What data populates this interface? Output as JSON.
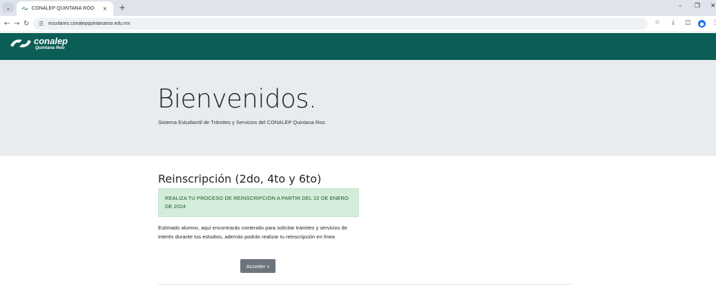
{
  "browser": {
    "tab_title": "CONALEP QUINTANA ROO",
    "tab_close": "×",
    "new_tab": "+",
    "url": "escolares.conalepquintanaroo.edu.mx",
    "icons": {
      "tab_menu": "chevron-down-icon",
      "back": "arrow-left-icon",
      "forward": "arrow-right-icon",
      "reload": "reload-icon",
      "site_info": "tune-icon",
      "bookmark": "star-icon",
      "downloads": "download-icon",
      "side_panel": "side-panel-icon",
      "profile": "profile-icon",
      "menu": "kebab-menu-icon",
      "minimize": "minimize-icon",
      "restore": "restore-icon",
      "close": "close-icon"
    }
  },
  "header": {
    "logo_main": "conalep",
    "logo_sub": "Quintana Roo",
    "brand_color": "#0b5e56"
  },
  "hero": {
    "title": "Bienvenidos.",
    "subtitle": "Sistema Estudiantil de Trámites y Servicios del CONALEP Quintana Roo"
  },
  "content": {
    "title": "Reinscripción (2do, 4to y 6to)",
    "alert": "REALIZA TU PROCESO DE REINSCRIPCIÓN A PARTIR DEL 22 DE ENERO DE 2024",
    "description": "Estimado alumno, aquí encontrarás contenido para solicitar trámites y servicios de interés durante tus estudios, además podrás realizar tu reinscripción en línea",
    "button_label": "Acceder »"
  }
}
